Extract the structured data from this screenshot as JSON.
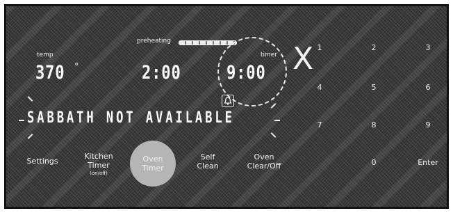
{
  "display": {
    "preheating_label": "preheating",
    "temp_label": "temp",
    "temp_value": "370",
    "temp_unit": "°",
    "cook_time_value": "2:00",
    "timer_label": "timer",
    "timer_value": "9:00",
    "close_mark": "X",
    "message": "SABBATH NOT AVAILABLE"
  },
  "buttons": {
    "settings": "Settings",
    "kitchen_timer_line1": "Kitchen",
    "kitchen_timer_line2": "Timer",
    "kitchen_timer_sub": "(on/off)",
    "oven_timer_line1": "Oven",
    "oven_timer_line2": "Timer",
    "self_clean_line1": "Self",
    "self_clean_line2": "Clean",
    "oven_clear_line1": "Oven",
    "oven_clear_line2": "Clear/Off",
    "enter": "Enter"
  },
  "keypad": [
    "1",
    "2",
    "3",
    "4",
    "5",
    "6",
    "7",
    "8",
    "9",
    "0"
  ],
  "icons": [
    "bell-icon",
    "timer-highlight-circle",
    "preheat-progress-bar"
  ],
  "colors": {
    "panel": "#3a3a3a",
    "text": "#f2f2f2",
    "highlight": "#b5b5b5"
  }
}
